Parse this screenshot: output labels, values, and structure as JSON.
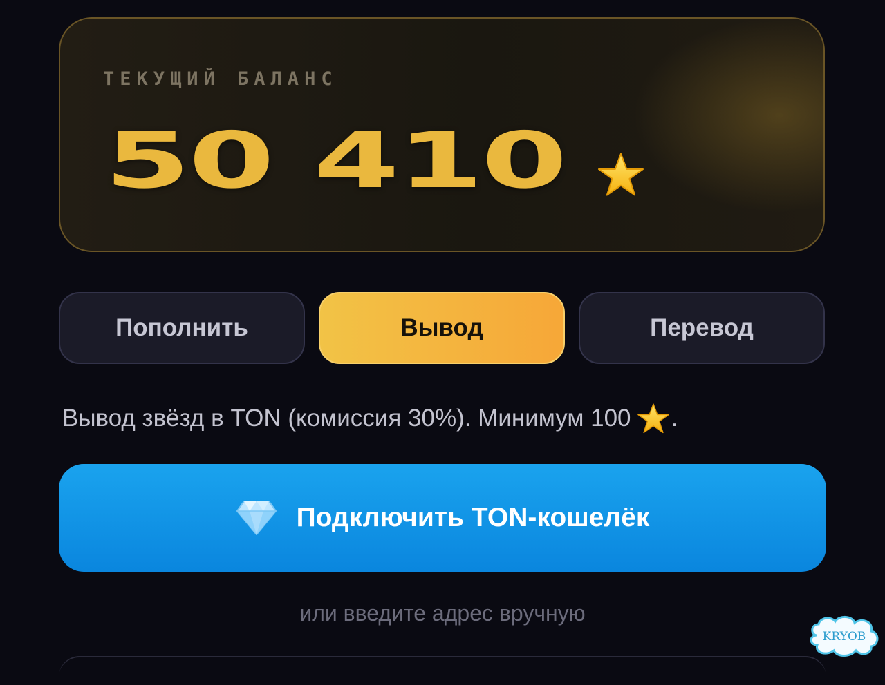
{
  "balance": {
    "label": "ТЕКУЩИЙ БАЛАНС",
    "amount": "50 410",
    "currency_icon": "star-icon"
  },
  "actions": {
    "topup_label": "Пополнить",
    "withdraw_label": "Вывод",
    "transfer_label": "Перевод",
    "active": "withdraw"
  },
  "withdraw": {
    "info_text": "Вывод звёзд в TON (комиссия 30%). Минимум 100",
    "info_suffix": ".",
    "connect_icon": "diamond-icon",
    "connect_label": "Подключить TON-кошелёк",
    "manual_label": "или введите адрес вручную"
  },
  "watermark": {
    "text": "KRYOB"
  },
  "colors": {
    "background": "#0a0a12",
    "gold": "#eab83e",
    "accent_orange": "#f6a738",
    "ton_blue": "#1a9be8"
  }
}
